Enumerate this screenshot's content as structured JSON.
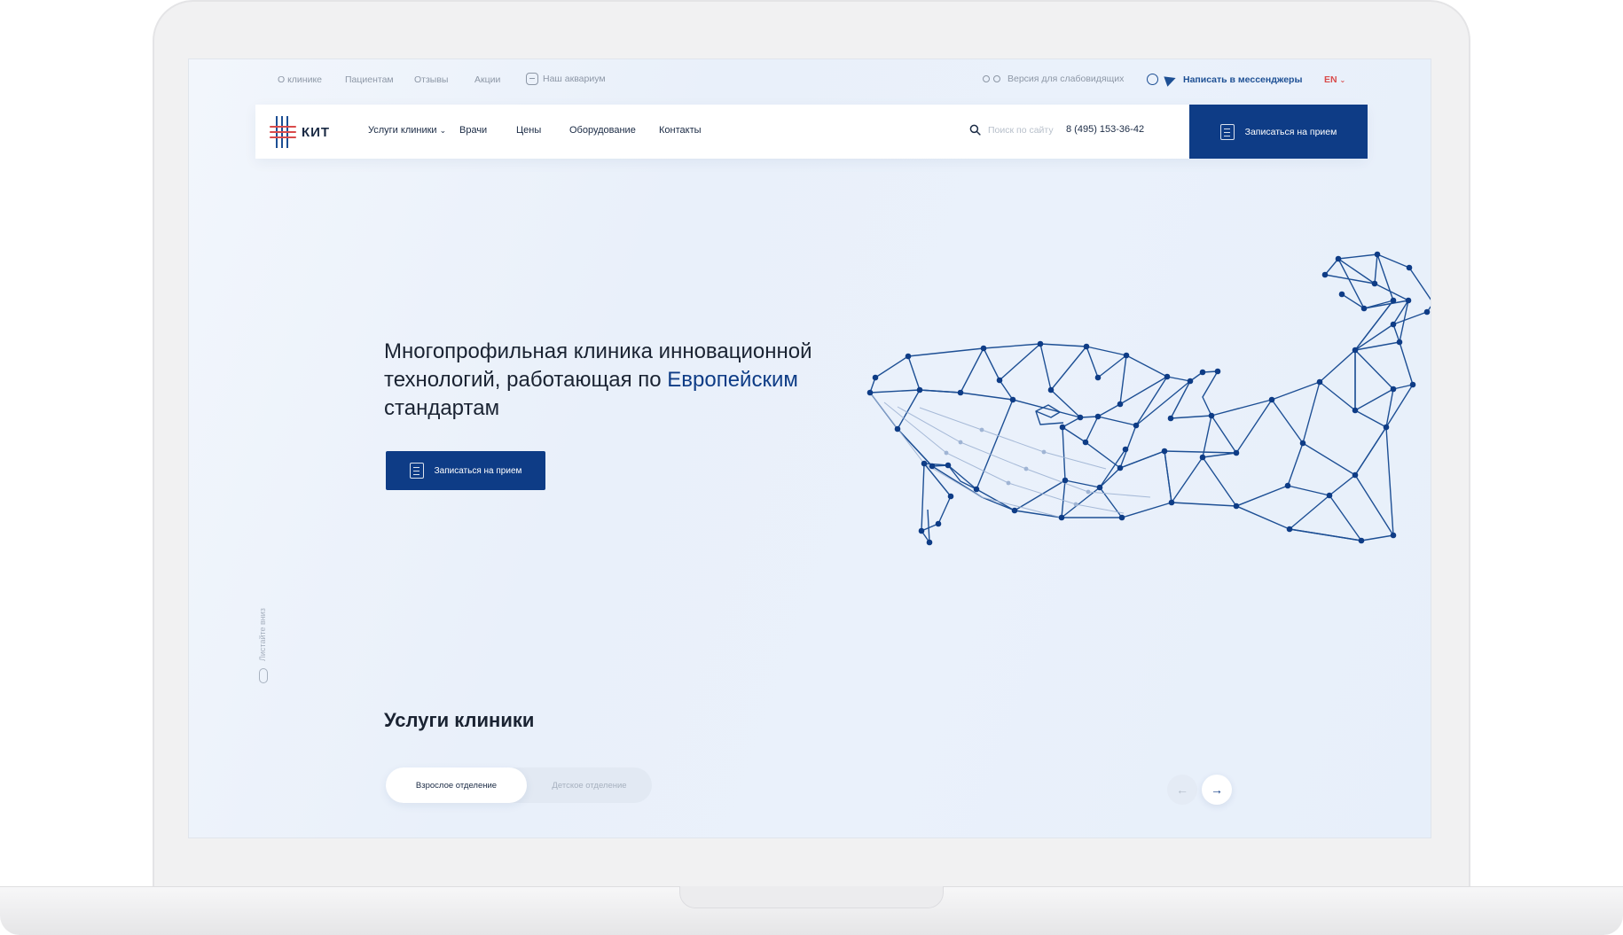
{
  "topbar": {
    "links": [
      "О клинике",
      "Пациентам",
      "Отзывы",
      "Акции"
    ],
    "aquarium": "Наш аквариум",
    "vision": "Версия для слабовидящих",
    "messenger": "Написать в мессенджеры",
    "lang": "EN"
  },
  "header": {
    "logo_text": "КИТ",
    "nav": [
      "Услуги клиники",
      "Врачи",
      "Цены",
      "Оборудование",
      "Контакты"
    ],
    "search_placeholder": "Поиск по сайту",
    "phone": "8 (495) 153-36-42",
    "cta": "Записаться на прием"
  },
  "hero": {
    "title_part1": "Многопрофильная клиника инновационной технологий, работающая по ",
    "title_accent": "Европейским",
    "title_part2": " стандартам",
    "cta": "Записаться на прием"
  },
  "scroll_hint": "Листайте вниз",
  "services": {
    "title": "Услуги  клиники",
    "tabs": [
      "Взрослое отделение",
      "Детское отделение"
    ],
    "prev": "←",
    "next": "→"
  },
  "colors": {
    "primary": "#0e3c86",
    "accent_red": "#d94b4b",
    "text": "#1a2332",
    "muted": "#8d97a6"
  }
}
